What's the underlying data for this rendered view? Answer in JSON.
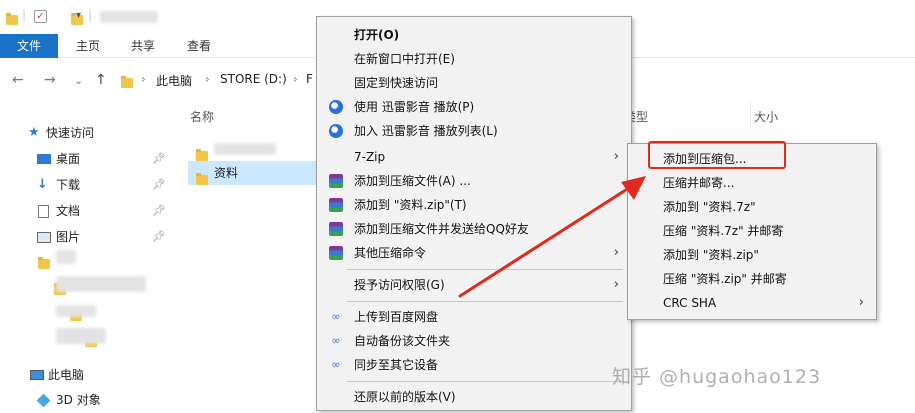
{
  "ribbon": {
    "tabs": [
      {
        "label": "文件"
      },
      {
        "label": "主页"
      },
      {
        "label": "共享"
      },
      {
        "label": "查看"
      }
    ]
  },
  "address": {
    "back": "←",
    "forward": "→",
    "dropdown": "⌄",
    "up": "↑",
    "crumbs": [
      "此电脑",
      "STORE (D:)",
      "F"
    ]
  },
  "sidebar": {
    "items": [
      {
        "label": "快速访问"
      },
      {
        "label": "桌面"
      },
      {
        "label": "下载"
      },
      {
        "label": "文档"
      },
      {
        "label": "图片"
      },
      {
        "label": "此电脑"
      },
      {
        "label": "3D 对象"
      }
    ]
  },
  "files": {
    "col_name": "名称",
    "col_type": "类型",
    "col_size": "大小",
    "rows": [
      {
        "name": "资料",
        "selected": true
      }
    ]
  },
  "context_menu": {
    "items": [
      {
        "label": "打开(O)",
        "bold": true
      },
      {
        "label": "在新窗口中打开(E)"
      },
      {
        "label": "固定到快速访问"
      },
      {
        "label": "使用 迅雷影音 播放(P)",
        "icon": "xunlei-icon"
      },
      {
        "label": "加入 迅雷影音 播放列表(L)",
        "icon": "xunlei-icon"
      },
      {
        "label": "7-Zip",
        "submenu": true
      },
      {
        "label": "添加到压缩文件(A) ...",
        "icon": "winrar-icon"
      },
      {
        "label": "添加到 \"资料.zip\"(T)",
        "icon": "winrar-icon"
      },
      {
        "label": "添加到压缩文件并发送给QQ好友",
        "icon": "winrar-icon"
      },
      {
        "label": "其他压缩命令",
        "icon": "winrar-icon",
        "submenu": true
      },
      {
        "label": "授予访问权限(G)",
        "submenu": true
      },
      {
        "label": "上传到百度网盘",
        "icon": "baidu-netdisk-icon"
      },
      {
        "label": "自动备份该文件夹",
        "icon": "baidu-netdisk-icon"
      },
      {
        "label": "同步至其它设备",
        "icon": "baidu-netdisk-icon"
      },
      {
        "label": "还原以前的版本(V)"
      }
    ]
  },
  "sevenzip_submenu": {
    "items": [
      {
        "label": "添加到压缩包..."
      },
      {
        "label": "压缩并邮寄..."
      },
      {
        "label": "添加到 \"资料.7z\""
      },
      {
        "label": "压缩 \"资料.7z\" 并邮寄"
      },
      {
        "label": "添加到 \"资料.zip\""
      },
      {
        "label": "压缩 \"资料.zip\" 并邮寄"
      },
      {
        "label": "CRC SHA",
        "submenu": true
      }
    ]
  },
  "watermark": "知乎 @hugaohao123",
  "colors": {
    "accent": "#1a73c8",
    "selection": "#cce8ff",
    "annotation_red": "#e3281d",
    "menu_bg": "#f2f2f2"
  }
}
